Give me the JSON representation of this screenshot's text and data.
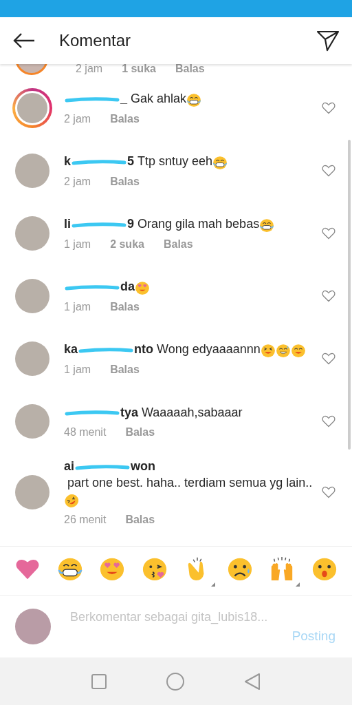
{
  "header": {
    "title": "Komentar"
  },
  "previous_comment": {
    "time": "2 jam",
    "likes": "1 suka",
    "reply": "Balas",
    "story": true
  },
  "comments": [
    {
      "user_end": "_",
      "text": "Gak ahlak",
      "emojis": [
        {
          "kind": "grin"
        }
      ],
      "time": "2 jam",
      "reply": "Balas",
      "story": true
    },
    {
      "user_start": "k",
      "user_end": "5",
      "text": "Ttp sntuy eeh",
      "emojis": [
        {
          "kind": "grin"
        }
      ],
      "time": "2 jam",
      "reply": "Balas",
      "story": false
    },
    {
      "user_start": "li",
      "user_end": "9",
      "text": "Orang gila mah bebas",
      "emojis": [
        {
          "kind": "grin"
        }
      ],
      "time": "1 jam",
      "likes": "2 suka",
      "reply": "Balas",
      "story": false
    },
    {
      "user_end": "da",
      "emojis": [
        {
          "kind": "heart-eyes"
        }
      ],
      "time": "1 jam",
      "reply": "Balas",
      "story": false
    },
    {
      "user_start": "ka",
      "user_end": "nto",
      "text": "Wong edyaaaannn",
      "emojis": [
        {
          "kind": "squint"
        },
        {
          "kind": "sweat-smile"
        },
        {
          "kind": "smile"
        }
      ],
      "time": "1 jam",
      "reply": "Balas",
      "story": false
    },
    {
      "user_end": "tya",
      "text": "Waaaaah,sabaaar",
      "time": "48 menit",
      "reply": "Balas",
      "story": false
    },
    {
      "user_start": "ai",
      "user_end": "won",
      "text": "part one best. haha.. terdiam semua yg lain..",
      "emojis": [
        {
          "kind": "rofl"
        }
      ],
      "time": "26 menit",
      "reply": "Balas",
      "story": false
    }
  ],
  "reactions": [
    {
      "kind": "heart",
      "has_variants": false
    },
    {
      "kind": "grin",
      "has_variants": false
    },
    {
      "kind": "heart-eyes",
      "has_variants": false
    },
    {
      "kind": "kiss",
      "has_variants": false
    },
    {
      "kind": "clap",
      "has_variants": true
    },
    {
      "kind": "sad",
      "has_variants": false
    },
    {
      "kind": "hands",
      "has_variants": true
    },
    {
      "kind": "surprised",
      "has_variants": false
    }
  ],
  "composer": {
    "placeholder": "Berkomentar sebagai gita_lubis18...",
    "post": "Posting"
  }
}
